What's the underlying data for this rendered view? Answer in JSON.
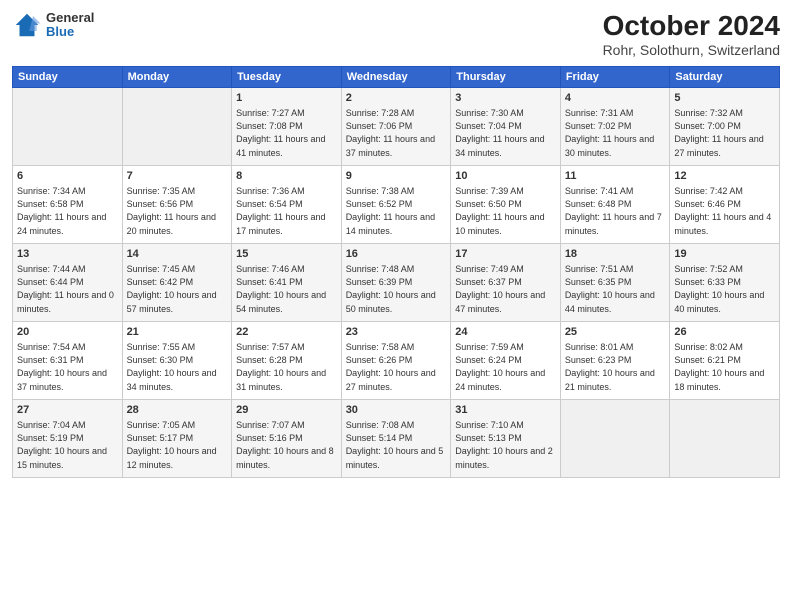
{
  "header": {
    "logo": {
      "line1": "General",
      "line2": "Blue"
    },
    "title": "October 2024",
    "subtitle": "Rohr, Solothurn, Switzerland"
  },
  "weekdays": [
    "Sunday",
    "Monday",
    "Tuesday",
    "Wednesday",
    "Thursday",
    "Friday",
    "Saturday"
  ],
  "weeks": [
    [
      {
        "day": "",
        "info": ""
      },
      {
        "day": "",
        "info": ""
      },
      {
        "day": "1",
        "info": "Sunrise: 7:27 AM\nSunset: 7:08 PM\nDaylight: 11 hours and 41 minutes."
      },
      {
        "day": "2",
        "info": "Sunrise: 7:28 AM\nSunset: 7:06 PM\nDaylight: 11 hours and 37 minutes."
      },
      {
        "day": "3",
        "info": "Sunrise: 7:30 AM\nSunset: 7:04 PM\nDaylight: 11 hours and 34 minutes."
      },
      {
        "day": "4",
        "info": "Sunrise: 7:31 AM\nSunset: 7:02 PM\nDaylight: 11 hours and 30 minutes."
      },
      {
        "day": "5",
        "info": "Sunrise: 7:32 AM\nSunset: 7:00 PM\nDaylight: 11 hours and 27 minutes."
      }
    ],
    [
      {
        "day": "6",
        "info": "Sunrise: 7:34 AM\nSunset: 6:58 PM\nDaylight: 11 hours and 24 minutes."
      },
      {
        "day": "7",
        "info": "Sunrise: 7:35 AM\nSunset: 6:56 PM\nDaylight: 11 hours and 20 minutes."
      },
      {
        "day": "8",
        "info": "Sunrise: 7:36 AM\nSunset: 6:54 PM\nDaylight: 11 hours and 17 minutes."
      },
      {
        "day": "9",
        "info": "Sunrise: 7:38 AM\nSunset: 6:52 PM\nDaylight: 11 hours and 14 minutes."
      },
      {
        "day": "10",
        "info": "Sunrise: 7:39 AM\nSunset: 6:50 PM\nDaylight: 11 hours and 10 minutes."
      },
      {
        "day": "11",
        "info": "Sunrise: 7:41 AM\nSunset: 6:48 PM\nDaylight: 11 hours and 7 minutes."
      },
      {
        "day": "12",
        "info": "Sunrise: 7:42 AM\nSunset: 6:46 PM\nDaylight: 11 hours and 4 minutes."
      }
    ],
    [
      {
        "day": "13",
        "info": "Sunrise: 7:44 AM\nSunset: 6:44 PM\nDaylight: 11 hours and 0 minutes."
      },
      {
        "day": "14",
        "info": "Sunrise: 7:45 AM\nSunset: 6:42 PM\nDaylight: 10 hours and 57 minutes."
      },
      {
        "day": "15",
        "info": "Sunrise: 7:46 AM\nSunset: 6:41 PM\nDaylight: 10 hours and 54 minutes."
      },
      {
        "day": "16",
        "info": "Sunrise: 7:48 AM\nSunset: 6:39 PM\nDaylight: 10 hours and 50 minutes."
      },
      {
        "day": "17",
        "info": "Sunrise: 7:49 AM\nSunset: 6:37 PM\nDaylight: 10 hours and 47 minutes."
      },
      {
        "day": "18",
        "info": "Sunrise: 7:51 AM\nSunset: 6:35 PM\nDaylight: 10 hours and 44 minutes."
      },
      {
        "day": "19",
        "info": "Sunrise: 7:52 AM\nSunset: 6:33 PM\nDaylight: 10 hours and 40 minutes."
      }
    ],
    [
      {
        "day": "20",
        "info": "Sunrise: 7:54 AM\nSunset: 6:31 PM\nDaylight: 10 hours and 37 minutes."
      },
      {
        "day": "21",
        "info": "Sunrise: 7:55 AM\nSunset: 6:30 PM\nDaylight: 10 hours and 34 minutes."
      },
      {
        "day": "22",
        "info": "Sunrise: 7:57 AM\nSunset: 6:28 PM\nDaylight: 10 hours and 31 minutes."
      },
      {
        "day": "23",
        "info": "Sunrise: 7:58 AM\nSunset: 6:26 PM\nDaylight: 10 hours and 27 minutes."
      },
      {
        "day": "24",
        "info": "Sunrise: 7:59 AM\nSunset: 6:24 PM\nDaylight: 10 hours and 24 minutes."
      },
      {
        "day": "25",
        "info": "Sunrise: 8:01 AM\nSunset: 6:23 PM\nDaylight: 10 hours and 21 minutes."
      },
      {
        "day": "26",
        "info": "Sunrise: 8:02 AM\nSunset: 6:21 PM\nDaylight: 10 hours and 18 minutes."
      }
    ],
    [
      {
        "day": "27",
        "info": "Sunrise: 7:04 AM\nSunset: 5:19 PM\nDaylight: 10 hours and 15 minutes."
      },
      {
        "day": "28",
        "info": "Sunrise: 7:05 AM\nSunset: 5:17 PM\nDaylight: 10 hours and 12 minutes."
      },
      {
        "day": "29",
        "info": "Sunrise: 7:07 AM\nSunset: 5:16 PM\nDaylight: 10 hours and 8 minutes."
      },
      {
        "day": "30",
        "info": "Sunrise: 7:08 AM\nSunset: 5:14 PM\nDaylight: 10 hours and 5 minutes."
      },
      {
        "day": "31",
        "info": "Sunrise: 7:10 AM\nSunset: 5:13 PM\nDaylight: 10 hours and 2 minutes."
      },
      {
        "day": "",
        "info": ""
      },
      {
        "day": "",
        "info": ""
      }
    ]
  ]
}
